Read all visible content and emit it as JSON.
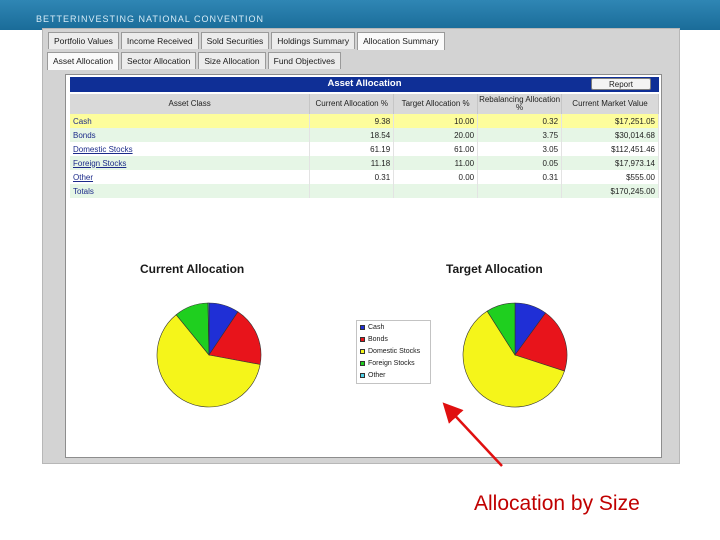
{
  "slide": {
    "header_title": "BETTERINVESTING NATIONAL CONVENTION",
    "caption": "Allocation by Size"
  },
  "tabs_main": [
    "Portfolio Values",
    "Income Received",
    "Sold Securities",
    "Holdings Summary",
    "Allocation Summary"
  ],
  "tabs_sub": [
    "Asset Allocation",
    "Sector Allocation",
    "Size Allocation",
    "Fund Objectives"
  ],
  "table": {
    "title": "Asset Allocation",
    "report_button": "Report",
    "headers": [
      "Asset Class",
      "Current Allocation %",
      "Target Allocation %",
      "Rebalancing Allocation %",
      "Current Market Value"
    ],
    "rows": [
      {
        "name": "Cash",
        "current": "9.38",
        "target": "10.00",
        "rebal": "0.32",
        "value": "$17,251.05"
      },
      {
        "name": "Bonds",
        "current": "18.54",
        "target": "20.00",
        "rebal": "3.75",
        "value": "$30,014.68"
      },
      {
        "name": "Domestic Stocks",
        "current": "61.19",
        "target": "61.00",
        "rebal": "3.05",
        "value": "$112,451.46"
      },
      {
        "name": "Foreign Stocks",
        "current": "11.18",
        "target": "11.00",
        "rebal": "0.05",
        "value": "$17,973.14"
      },
      {
        "name": "Other",
        "current": "0.31",
        "target": "0.00",
        "rebal": "0.31",
        "value": "$555.00"
      }
    ],
    "total_label": "Totals",
    "total_value": "$170,245.00"
  },
  "charts": {
    "current_title": "Current Allocation",
    "target_title": "Target Allocation"
  },
  "legend": [
    {
      "label": "Cash",
      "color": "#1f2fd6"
    },
    {
      "label": "Bonds",
      "color": "#e8141b"
    },
    {
      "label": "Domestic Stocks",
      "color": "#f5f51a"
    },
    {
      "label": "Foreign Stocks",
      "color": "#1fcf1f"
    },
    {
      "label": "Other",
      "color": "#4fd0e8"
    }
  ],
  "pies": {
    "current": [
      9.38,
      18.54,
      61.19,
      10.58,
      0.31
    ],
    "target": [
      10,
      20,
      61,
      9,
      0
    ]
  },
  "colors": {
    "header_band": "#1a6c99",
    "table_title_bg": "#0f2f96",
    "caption": "#c00000",
    "arrow": "#e01010"
  }
}
